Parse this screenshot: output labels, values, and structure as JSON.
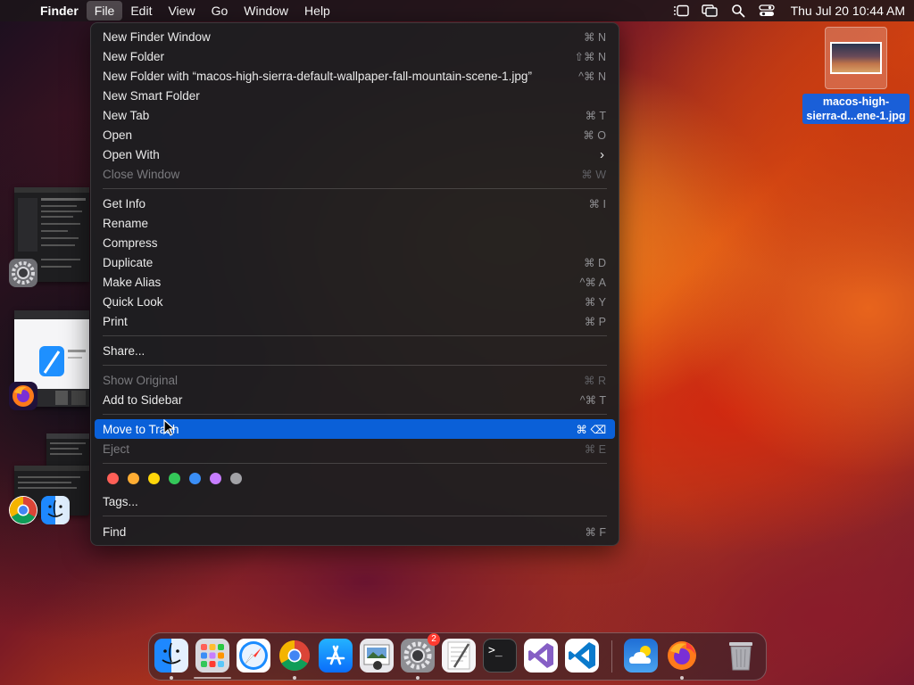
{
  "menubar": {
    "apple_glyph": "",
    "items": [
      {
        "label": "Finder"
      },
      {
        "label": "File"
      },
      {
        "label": "Edit"
      },
      {
        "label": "View"
      },
      {
        "label": "Go"
      },
      {
        "label": "Window"
      },
      {
        "label": "Help"
      }
    ],
    "status_icons": [
      "stage-manager-icon",
      "screen-mirroring-icon",
      "spotlight-search-icon",
      "control-center-icon"
    ],
    "clock": "Thu Jul 20  10:44 AM"
  },
  "file_menu": {
    "items": [
      {
        "label": "New Finder Window",
        "shortcut": "⌘ N"
      },
      {
        "label": "New Folder",
        "shortcut": "⇧⌘ N"
      },
      {
        "label": "New Folder with “macos-high-sierra-default-wallpaper-fall-mountain-scene-1.jpg”",
        "shortcut": "^⌘ N"
      },
      {
        "label": "New Smart Folder",
        "shortcut": ""
      },
      {
        "label": "New Tab",
        "shortcut": "⌘ T"
      },
      {
        "label": "Open",
        "shortcut": "⌘ O"
      },
      {
        "label": "Open With",
        "shortcut": "›"
      },
      {
        "label": "Close Window",
        "shortcut": "⌘ W"
      },
      {
        "label": "Get Info",
        "shortcut": "⌘ I"
      },
      {
        "label": "Rename",
        "shortcut": ""
      },
      {
        "label": "Compress",
        "shortcut": ""
      },
      {
        "label": "Duplicate",
        "shortcut": "⌘ D"
      },
      {
        "label": "Make Alias",
        "shortcut": "^⌘ A"
      },
      {
        "label": "Quick Look",
        "shortcut": "⌘ Y"
      },
      {
        "label": "Print",
        "shortcut": "⌘ P"
      },
      {
        "label": "Share...",
        "shortcut": ""
      },
      {
        "label": "Show Original",
        "shortcut": "⌘ R"
      },
      {
        "label": "Add to Sidebar",
        "shortcut": "^⌘ T"
      },
      {
        "label": "Move to Trash",
        "shortcut": "⌘ ⌫"
      },
      {
        "label": "Eject",
        "shortcut": "⌘ E"
      },
      {
        "label": "Tags...",
        "shortcut": ""
      },
      {
        "label": "Find",
        "shortcut": "⌘ F"
      }
    ],
    "tag_colors": [
      "#ff5f57",
      "#ffad33",
      "#ffd60a",
      "#34c759",
      "#3a8ef6",
      "#c77dff",
      "#a2a2a6"
    ],
    "highlight_color": "#0a60d8"
  },
  "desktop_file": {
    "name_line1": "macos-high-",
    "name_line2": "sierra-d...ene-1.jpg"
  },
  "dock": {
    "apps": [
      "finder-icon",
      "launchpad-icon",
      "safari-icon",
      "chrome-icon",
      "app-store-icon",
      "preview-icon",
      "system-settings-icon",
      "textedit-icon",
      "terminal-icon",
      "visual-studio-icon",
      "vscode-icon",
      "weather-icon",
      "firefox-icon",
      "trash-icon"
    ],
    "settings_badge": "2",
    "terminal_glyph": ">_"
  }
}
